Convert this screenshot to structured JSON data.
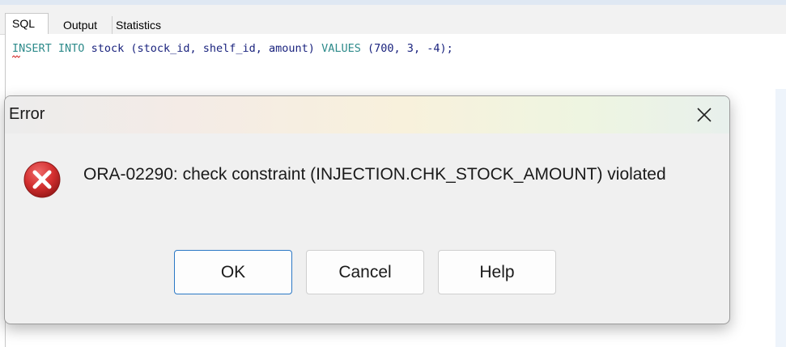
{
  "tabs": [
    {
      "label": "SQL",
      "active": true
    },
    {
      "label": "Output",
      "active": false
    },
    {
      "label": "Statistics",
      "active": false
    }
  ],
  "editor": {
    "tokens": {
      "insert": "INSERT",
      "into": "INTO",
      "table": "stock",
      "columns": "(stock_id, shelf_id, amount)",
      "values": "VALUES",
      "open": "(",
      "v1": "700",
      "v2": "3",
      "v3": "-4",
      "close": ");"
    },
    "colors": {
      "keyword": "#2e8b8b",
      "identifier": "#1a237e"
    }
  },
  "dialog": {
    "title": "Error",
    "close_icon": "close-icon",
    "icon": "error-icon",
    "message": "ORA-02290: check constraint (INJECTION.CHK_STOCK_AMOUNT) violated",
    "buttons": {
      "ok": "OK",
      "cancel": "Cancel",
      "help": "Help"
    },
    "colors": {
      "error": "#c62828",
      "primary_border": "#2b78c5"
    }
  }
}
